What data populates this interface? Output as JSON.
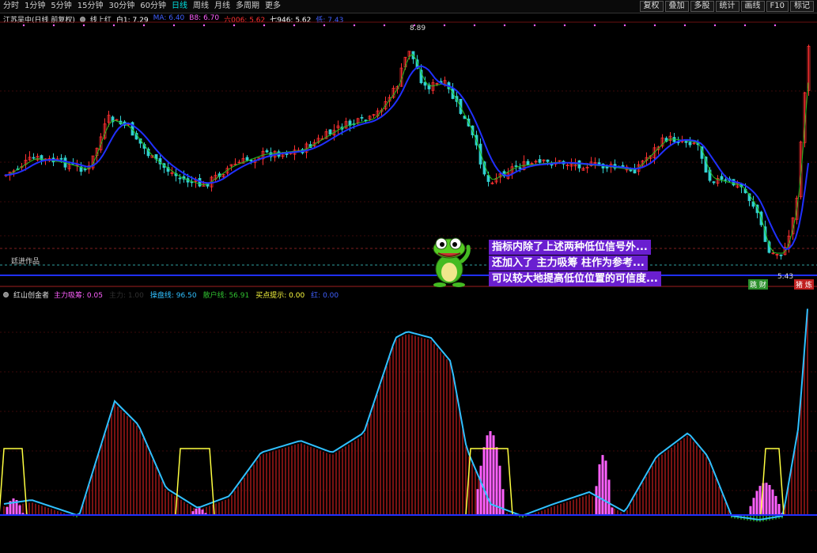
{
  "toolbar": {
    "periods": [
      "分时",
      "1分钟",
      "5分钟",
      "15分钟",
      "30分钟",
      "60分钟",
      "日线",
      "周线",
      "月线",
      "多周期",
      "更多"
    ],
    "active_period": "日线",
    "right_buttons": [
      "复权",
      "叠加",
      "多股",
      "统计",
      "画线",
      "F10",
      "标记"
    ]
  },
  "main_legend": {
    "stock": "江苏吴中(日线 前复权)",
    "indicator": "线上红",
    "values": [
      {
        "text": "白1: 7.29",
        "color": "#ffffff"
      },
      {
        "text": "MA: 6.40",
        "color": "#4060ff"
      },
      {
        "text": "B8: 6.70",
        "color": "#ff60ff"
      },
      {
        "text": "六006: 5.62",
        "color": "#ff3030"
      },
      {
        "text": "七946: 5.62",
        "color": "#ffffff"
      },
      {
        "text": "低: 7.43",
        "color": "#4060ff"
      }
    ]
  },
  "sub_legend": {
    "name": "红山创金者",
    "values": [
      {
        "text": "主力吸筹: 0.05",
        "color": "#ff60ff"
      },
      {
        "text": "主力: 1.00",
        "color": "#303030"
      },
      {
        "text": "操盘线: 96.50",
        "color": "#30c0ff"
      },
      {
        "text": "散户线: 56.91",
        "color": "#30c030"
      },
      {
        "text": "买点提示: 0.00",
        "color": "#ffff40"
      },
      {
        "text": "红: 0.00",
        "color": "#4060ff"
      }
    ]
  },
  "price_labels": {
    "high": "8.89",
    "low": "5.43"
  },
  "studio_label": "廷进作品",
  "badges": {
    "left": "跳 财",
    "right": "猪 炼"
  },
  "callout": {
    "lines": [
      "指标内除了上述两种低位信号外...",
      "还加入了 主力吸筹 柱作为参考...",
      "可以较大地提高低位位置的可信度..."
    ]
  },
  "chart_data": {
    "type": "candlestick",
    "price_high": 8.89,
    "price_low": 5.43,
    "ma_color": "#2030ff",
    "up_color": "#ff3030",
    "down_color": "#30d0d0"
  }
}
